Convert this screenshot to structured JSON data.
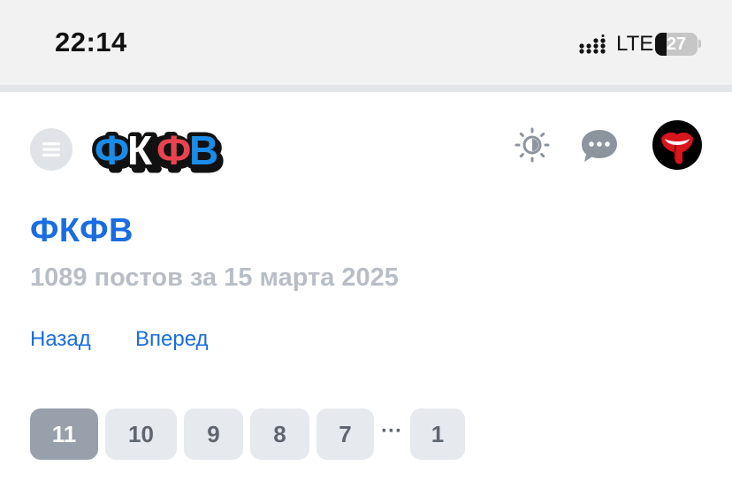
{
  "status_bar": {
    "time": "22:14",
    "network": "LTE",
    "battery_percent": "27",
    "battery_level": 0.27
  },
  "header": {
    "logo_text": "ФКФВ",
    "icons": [
      "menu-icon",
      "theme-sun-icon",
      "chat-bubble-icon",
      "avatar"
    ]
  },
  "main": {
    "title": "ФКФВ",
    "subtitle": "1089 постов за 15 марта 2025",
    "nav": {
      "back": "Назад",
      "forward": "Вперед"
    },
    "pagination": {
      "pages": [
        "11",
        "10",
        "9",
        "8",
        "7"
      ],
      "ellipsis": "···",
      "last": "1",
      "active": "11"
    }
  },
  "colors": {
    "accent": "#1a6de0",
    "subtitle": "#b9bec6",
    "page_active": "#97a0ab",
    "page_inactive": "#e6e9ed",
    "logo_blue": "#1a8ce8",
    "logo_red": "#e8434f"
  }
}
